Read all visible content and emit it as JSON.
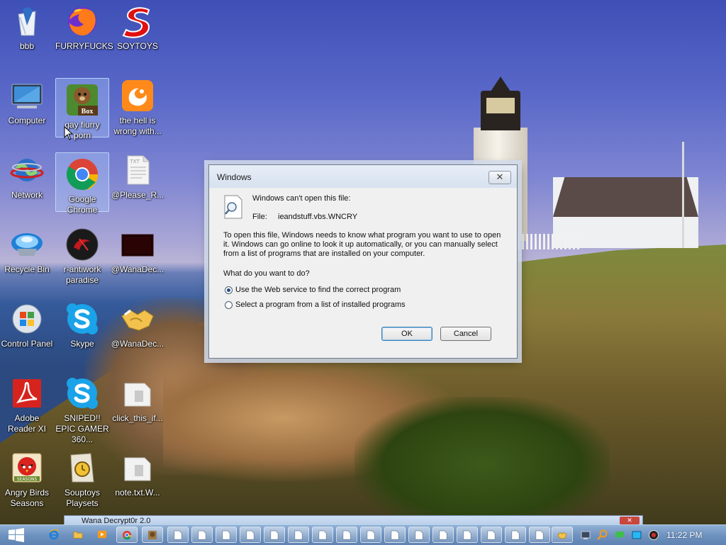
{
  "desktop": {
    "icons": [
      {
        "label": "bbb"
      },
      {
        "label": "FURRYFUCKS"
      },
      {
        "label": "SOYTOYS"
      },
      {
        "label": "Computer"
      },
      {
        "label": "gay fiurry porn"
      },
      {
        "label": "the hell is wrong with..."
      },
      {
        "label": "Network"
      },
      {
        "label": "Google Chrome"
      },
      {
        "label": "@Please_R..."
      },
      {
        "label": "Recycle Bin"
      },
      {
        "label": "r-antiwork paradise"
      },
      {
        "label": "@WanaDec..."
      },
      {
        "label": "Control Panel"
      },
      {
        "label": "Skype"
      },
      {
        "label": "@WanaDec..."
      },
      {
        "label": "Adobe Reader XI"
      },
      {
        "label": "SNIPED!! EPIC GAMER 360..."
      },
      {
        "label": "click_this_if..."
      },
      {
        "label": "Angry Birds Seasons"
      },
      {
        "label": "Souptoys Playsets"
      },
      {
        "label": "note.txt.W..."
      }
    ],
    "file_badge": "TXT",
    "box_badge": "Box",
    "seasons_badge": "SEASONS"
  },
  "dialog": {
    "title": "Windows",
    "close_glyph": "✕",
    "heading": "Windows can't open this file:",
    "file_label": "File:",
    "file_name": "ieandstuff.vbs.WNCRY",
    "description": "To open this file, Windows needs to know what program you want to use to open it. Windows can go online to look it up automatically, or you can manually select from a list of programs that are installed on your computer.",
    "question": "What do you want to do?",
    "options": [
      {
        "label": "Use the Web service to find the correct program",
        "selected": true
      },
      {
        "label": "Select a program from a list of installed programs",
        "selected": false
      }
    ],
    "ok_label": "OK",
    "cancel_label": "Cancel"
  },
  "background_window": {
    "title": "Wana Decrypt0r 2.0",
    "close_glyph": "✕"
  },
  "taskbar": {
    "clock": "11:22 PM",
    "accent": "#6f93c0"
  }
}
